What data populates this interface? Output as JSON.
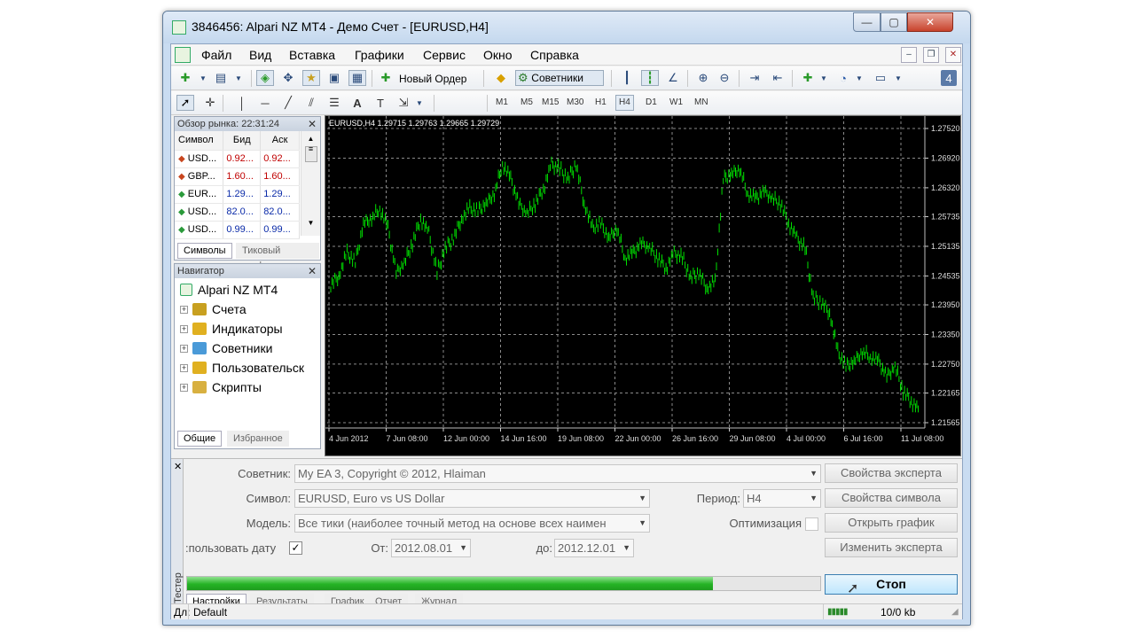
{
  "window": {
    "title": "3846456: Alpari NZ MT4 - Демо Счет - [EURUSD,H4]"
  },
  "menu": [
    "Файл",
    "Вид",
    "Вставка",
    "Графики",
    "Сервис",
    "Окно",
    "Справка"
  ],
  "toolbar": {
    "new_order": "Новый Ордер",
    "experts": "Советники",
    "timeframes": [
      "M1",
      "M5",
      "M15",
      "M30",
      "H1",
      "H4",
      "D1",
      "W1",
      "MN"
    ],
    "selected_timeframe": "H4"
  },
  "market_watch": {
    "title": "Обзор рынка: 22:31:24",
    "columns": [
      "Символ",
      "Бид",
      "Аск"
    ],
    "rows": [
      {
        "symbol": "USD...",
        "bid": "0.92...",
        "ask": "0.92...",
        "dir": "down"
      },
      {
        "symbol": "GBP...",
        "bid": "1.60...",
        "ask": "1.60...",
        "dir": "down"
      },
      {
        "symbol": "EUR...",
        "bid": "1.29...",
        "ask": "1.29...",
        "dir": "up"
      },
      {
        "symbol": "USD...",
        "bid": "82.0...",
        "ask": "82.0...",
        "dir": "up"
      },
      {
        "symbol": "USD...",
        "bid": "0.99...",
        "ask": "0.99...",
        "dir": "up"
      }
    ],
    "tabs": [
      "Символы",
      "Тиковый график"
    ]
  },
  "navigator": {
    "title": "Навигатор",
    "root": "Alpari NZ MT4",
    "items": [
      "Счета",
      "Индикаторы",
      "Советники",
      "Пользовательск",
      "Скрипты"
    ],
    "icon_colors": [
      "#c8a020",
      "#e0b020",
      "#4a9ad8",
      "#e0b020",
      "#d8b040"
    ],
    "tabs": [
      "Общие",
      "Избранное"
    ]
  },
  "chart": {
    "label": "EURUSD,H4  1.29715 1.29763 1.29665 1.29729",
    "price_levels": [
      "1.27520",
      "1.26920",
      "1.26320",
      "1.25735",
      "1.25135",
      "1.24535",
      "1.23950",
      "1.23350",
      "1.22750",
      "1.22165",
      "1.21565"
    ],
    "time_labels": [
      "4 Jun 2012",
      "7 Jun 08:00",
      "12 Jun 00:00",
      "14 Jun 16:00",
      "19 Jun 08:00",
      "22 Jun 00:00",
      "26 Jun 16:00",
      "29 Jun 08:00",
      "4 Jul 00:00",
      "6 Jul 16:00",
      "11 Jul 08:00"
    ],
    "line_color": "#00e000",
    "close_series": [
      1.2435,
      1.2455,
      1.25,
      1.248,
      1.256,
      1.257,
      1.259,
      1.255,
      1.246,
      1.248,
      1.252,
      1.257,
      1.254,
      1.246,
      1.251,
      1.253,
      1.257,
      1.259,
      1.2585,
      1.26,
      1.262,
      1.268,
      1.265,
      1.26,
      1.258,
      1.26,
      1.263,
      1.268,
      1.267,
      1.265,
      1.268,
      1.26,
      1.255,
      1.256,
      1.253,
      1.255,
      1.249,
      1.25,
      1.252,
      1.251,
      1.249,
      1.247,
      1.25,
      1.249,
      1.245,
      1.246,
      1.243,
      1.244,
      1.265,
      1.266,
      1.267,
      1.262,
      1.261,
      1.2625,
      1.261,
      1.26,
      1.256,
      1.253,
      1.251,
      1.241,
      1.24,
      1.238,
      1.23,
      1.227,
      1.228,
      1.23,
      1.229,
      1.228,
      1.225,
      1.227,
      1.222,
      1.22,
      1.218
    ]
  },
  "tester": {
    "vertical_tab": "Тестер",
    "expert_label": "Советник:",
    "expert_value": "My EA 3, Copyright © 2012, Hlaiman",
    "symbol_label": "Символ:",
    "symbol_value": "EURUSD, Euro vs US Dollar",
    "period_label": "Период:",
    "period_value": "H4",
    "model_label": "Модель:",
    "model_value": "Все тики (наиболее точный метод на основе всех наимен",
    "optimization_label": "Оптимизация",
    "use_date_label": ":пользовать дату",
    "from_label": "От:",
    "from_value": "2012.08.01",
    "to_label": "до:",
    "to_value": "2012.12.01",
    "buttons": [
      "Свойства эксперта",
      "Свойства символа",
      "Открыть график",
      "Изменить эксперта"
    ],
    "stop_label": "Стоп",
    "progress": 0.83,
    "tabs": [
      "Настройки",
      "Результаты",
      "График",
      "Отчет",
      "Журнал"
    ]
  },
  "status": {
    "help": "Дл:",
    "profile": "Default",
    "traffic": "10/0 kb"
  }
}
